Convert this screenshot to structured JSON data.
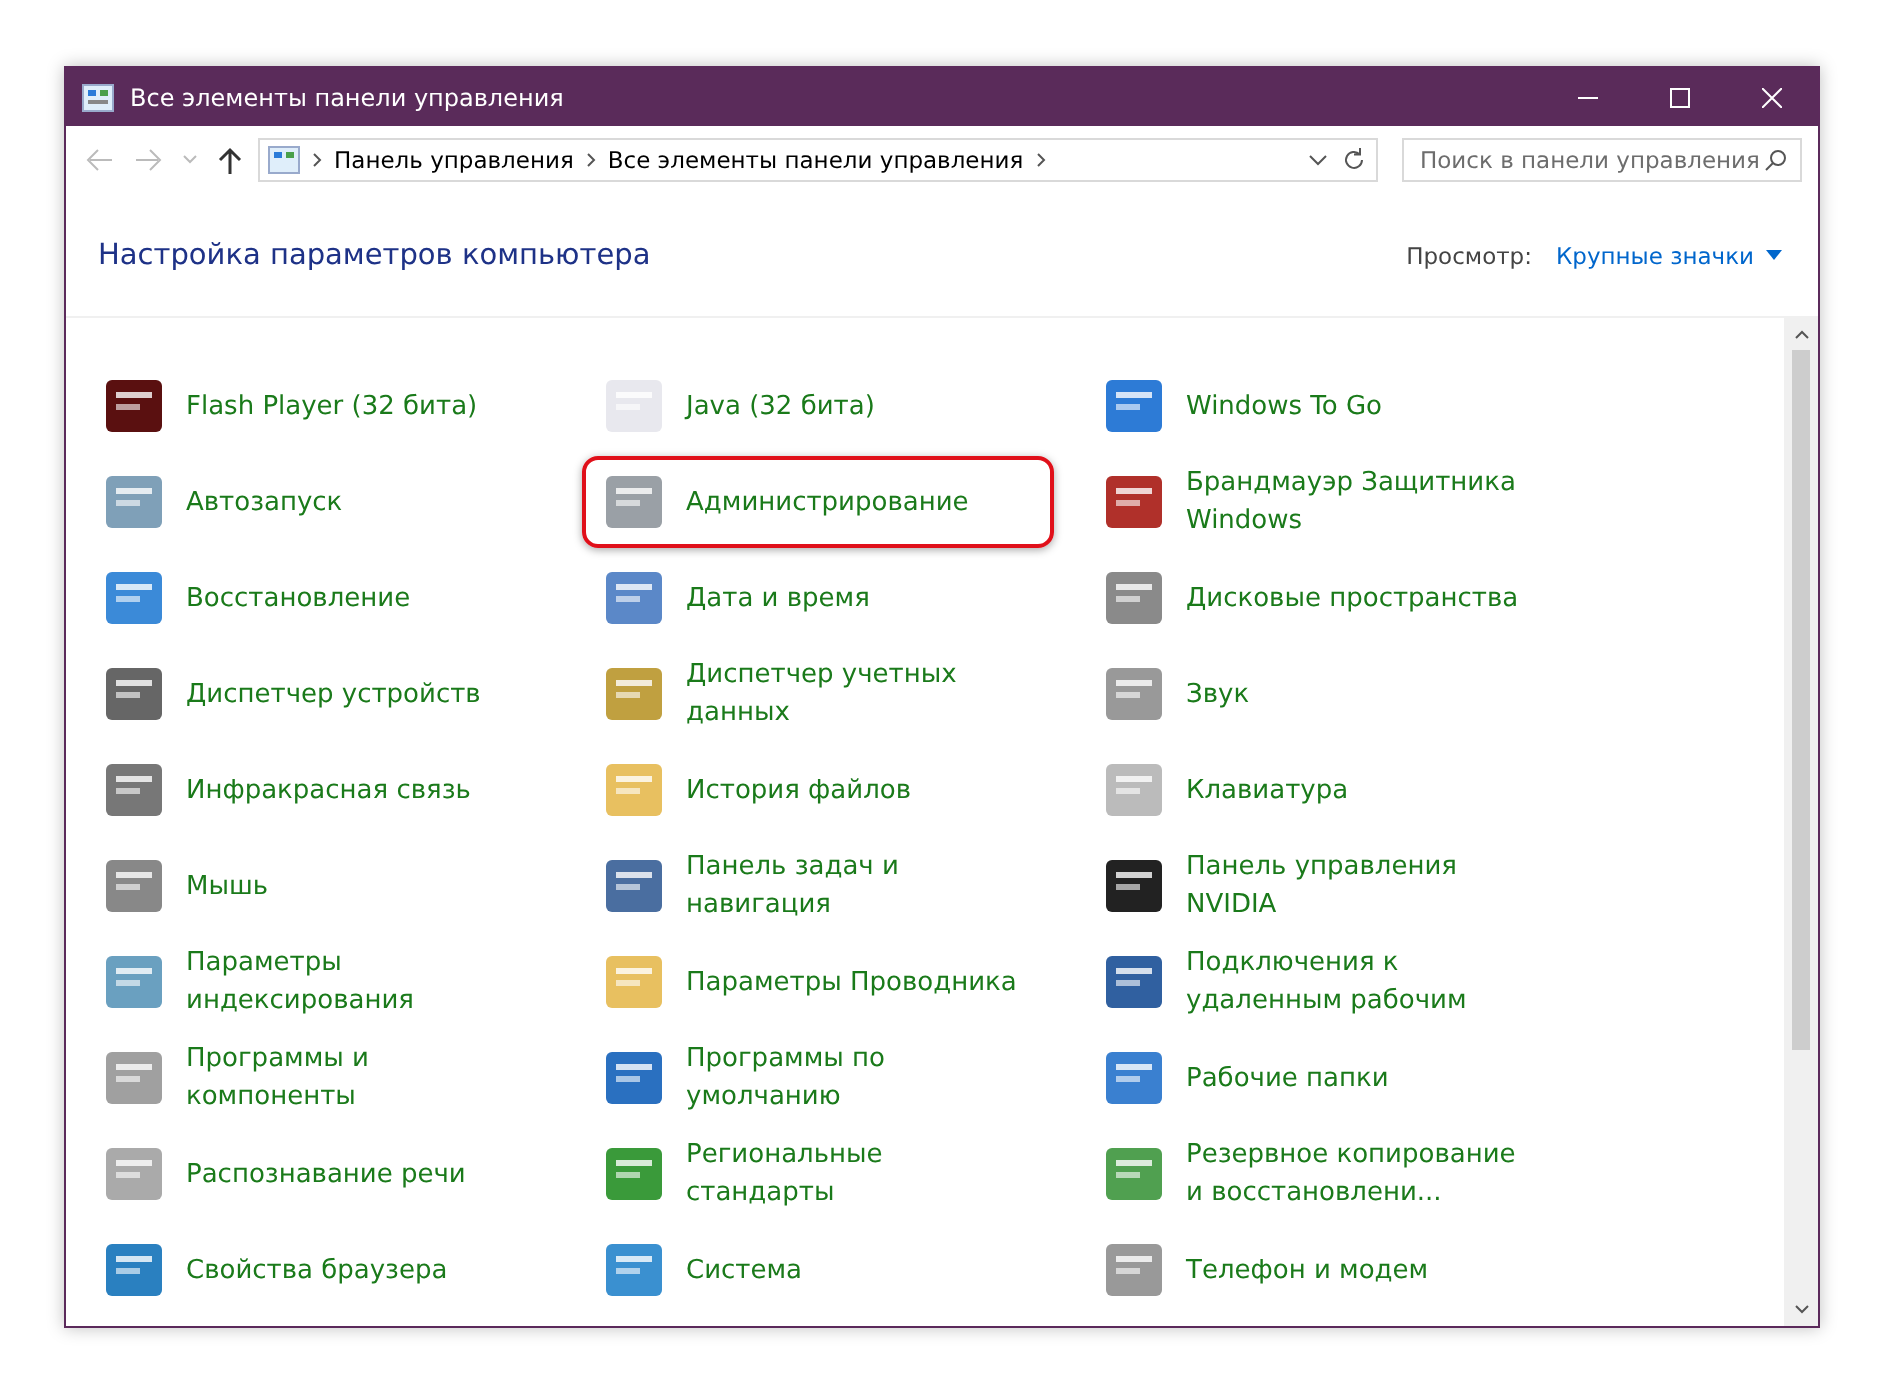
{
  "window": {
    "title": "Все элементы панели управления"
  },
  "address_bar": {
    "path": [
      "Панель управления",
      "Все элементы панели управления"
    ]
  },
  "search": {
    "placeholder": "Поиск в панели управления"
  },
  "header": {
    "title": "Настройка параметров компьютера",
    "view_label": "Просмотр:",
    "view_value": "Крупные значки"
  },
  "items": [
    {
      "label": "Flash Player (32 бита)",
      "highlighted": false
    },
    {
      "label": "Java (32 бита)",
      "highlighted": false
    },
    {
      "label": "Windows To Go",
      "highlighted": false
    },
    {
      "label": "Автозапуск",
      "highlighted": false
    },
    {
      "label": "Администрирование",
      "highlighted": true
    },
    {
      "label": "Брандмауэр Защитника Windows",
      "highlighted": false
    },
    {
      "label": "Восстановление",
      "highlighted": false
    },
    {
      "label": "Дата и время",
      "highlighted": false
    },
    {
      "label": "Дисковые пространства",
      "highlighted": false
    },
    {
      "label": "Диспетчер устройств",
      "highlighted": false
    },
    {
      "label": "Диспетчер учетных данных",
      "highlighted": false
    },
    {
      "label": "Звук",
      "highlighted": false
    },
    {
      "label": "Инфракрасная связь",
      "highlighted": false
    },
    {
      "label": "История файлов",
      "highlighted": false
    },
    {
      "label": "Клавиатура",
      "highlighted": false
    },
    {
      "label": "Мышь",
      "highlighted": false
    },
    {
      "label": "Панель задач и навигация",
      "highlighted": false
    },
    {
      "label": "Панель управления NVIDIA",
      "highlighted": false
    },
    {
      "label": "Параметры индексирования",
      "highlighted": false
    },
    {
      "label": "Параметры Проводника",
      "highlighted": false
    },
    {
      "label": "Подключения к удаленным рабочим",
      "highlighted": false
    },
    {
      "label": "Программы и компоненты",
      "highlighted": false
    },
    {
      "label": "Программы по умолчанию",
      "highlighted": false
    },
    {
      "label": "Рабочие папки",
      "highlighted": false
    },
    {
      "label": "Распознавание речи",
      "highlighted": false
    },
    {
      "label": "Региональные стандарты",
      "highlighted": false
    },
    {
      "label": "Резервное копирование и восстановлени...",
      "highlighted": false
    },
    {
      "label": "Свойства браузера",
      "highlighted": false
    },
    {
      "label": "Система",
      "highlighted": false
    },
    {
      "label": "Телефон и модем",
      "highlighted": false
    }
  ]
}
